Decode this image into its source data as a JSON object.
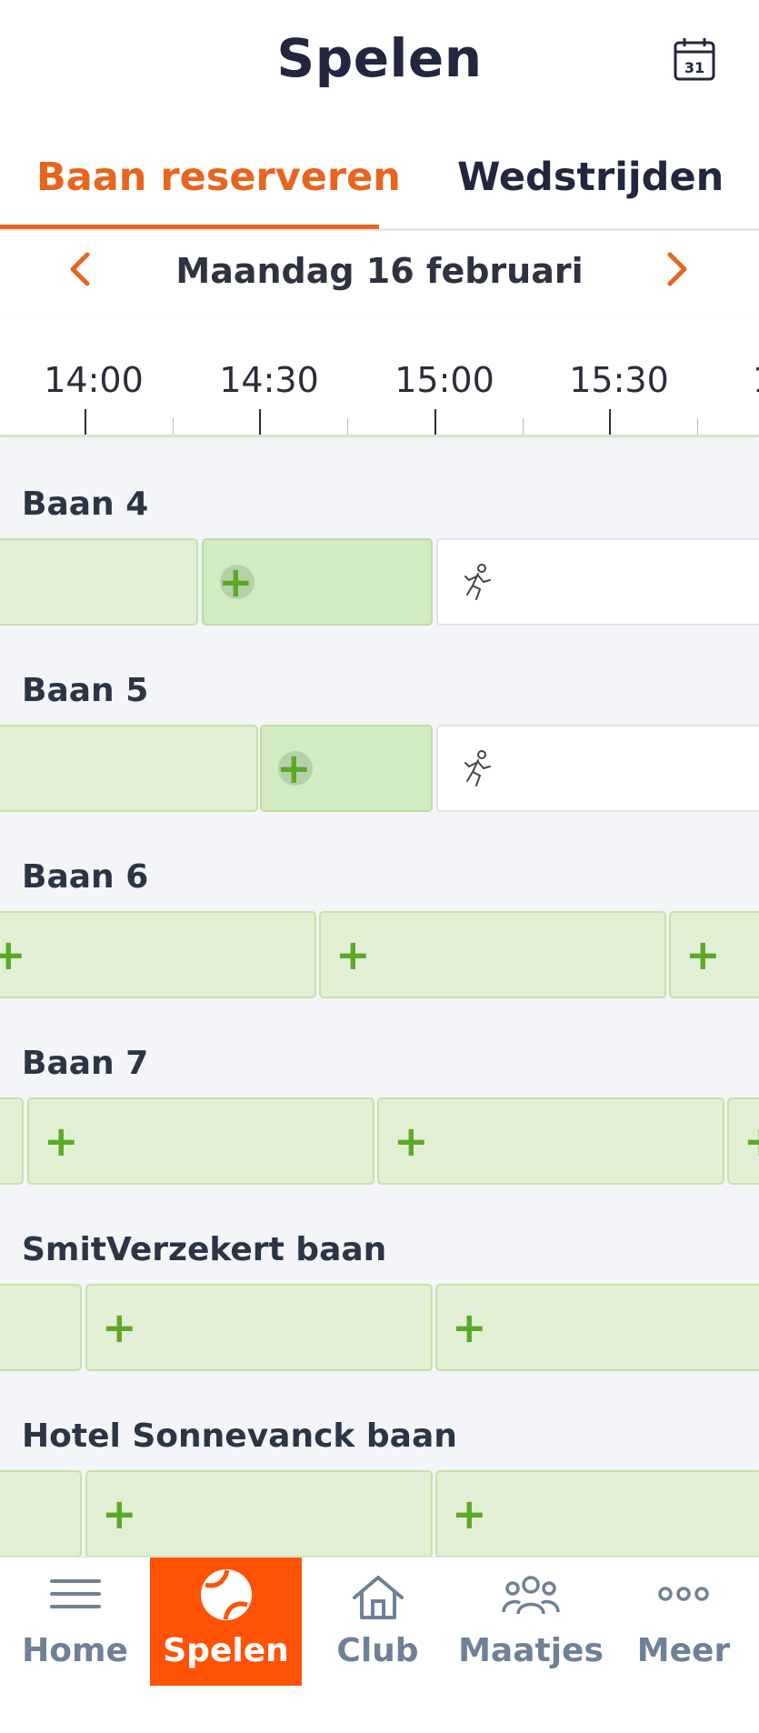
{
  "header": {
    "title": "Spelen",
    "calendar_day": "31"
  },
  "tabs": [
    {
      "label": "Baan reserveren",
      "active": true
    },
    {
      "label": "Wedstrijden",
      "active": false
    }
  ],
  "date": {
    "label": "Maandag 16 februari"
  },
  "timeline": {
    "labels": [
      "14:00",
      "14:30",
      "15:00",
      "15:30",
      "1"
    ]
  },
  "courts": [
    {
      "name": "Baan 4"
    },
    {
      "name": "Baan 5"
    },
    {
      "name": "Baan 6"
    },
    {
      "name": "Baan 7"
    },
    {
      "name": "SmitVerzekert baan"
    },
    {
      "name": "Hotel Sonnevanck baan"
    }
  ],
  "bottom_nav": [
    {
      "label": "Home",
      "icon": "menu-icon",
      "active": false
    },
    {
      "label": "Spelen",
      "icon": "tennis-ball-icon",
      "active": true
    },
    {
      "label": "Club",
      "icon": "house-icon",
      "active": false
    },
    {
      "label": "Maatjes",
      "icon": "group-icon",
      "active": false
    },
    {
      "label": "Meer",
      "icon": "more-icon",
      "active": false
    }
  ],
  "colors": {
    "accent": "#e8651f",
    "nav_active": "#ff5205",
    "slot_free": "#e1f0d4",
    "plus": "#5ea829"
  }
}
